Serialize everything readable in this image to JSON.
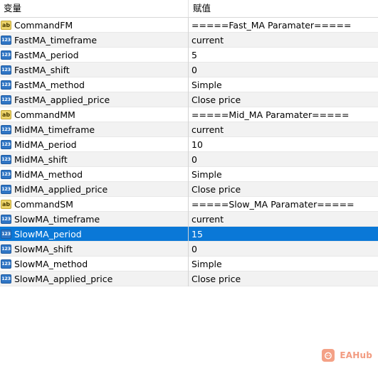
{
  "header": {
    "col_variable": "变量",
    "col_value": "赋值"
  },
  "rows": [
    {
      "icon": "string-type-icon",
      "glyph": "ab",
      "name": "CommandFM",
      "value": "=====Fast_MA Paramater====="
    },
    {
      "icon": "number-type-icon",
      "glyph": "123",
      "name": "FastMA_timeframe",
      "value": "current"
    },
    {
      "icon": "number-type-icon",
      "glyph": "123",
      "name": "FastMA_period",
      "value": "5"
    },
    {
      "icon": "number-type-icon",
      "glyph": "123",
      "name": "FastMA_shift",
      "value": "0"
    },
    {
      "icon": "number-type-icon",
      "glyph": "123",
      "name": "FastMA_method",
      "value": "Simple"
    },
    {
      "icon": "number-type-icon",
      "glyph": "123",
      "name": "FastMA_applied_price",
      "value": "Close price"
    },
    {
      "icon": "string-type-icon",
      "glyph": "ab",
      "name": "CommandMM",
      "value": "=====Mid_MA Paramater====="
    },
    {
      "icon": "number-type-icon",
      "glyph": "123",
      "name": "MidMA_timeframe",
      "value": "current"
    },
    {
      "icon": "number-type-icon",
      "glyph": "123",
      "name": "MidMA_period",
      "value": "10"
    },
    {
      "icon": "number-type-icon",
      "glyph": "123",
      "name": "MidMA_shift",
      "value": "0"
    },
    {
      "icon": "number-type-icon",
      "glyph": "123",
      "name": "MidMA_method",
      "value": "Simple"
    },
    {
      "icon": "number-type-icon",
      "glyph": "123",
      "name": "MidMA_applied_price",
      "value": "Close price"
    },
    {
      "icon": "string-type-icon",
      "glyph": "ab",
      "name": "CommandSM",
      "value": "=====Slow_MA Paramater====="
    },
    {
      "icon": "number-type-icon",
      "glyph": "123",
      "name": "SlowMA_timeframe",
      "value": "current"
    },
    {
      "icon": "number-type-icon",
      "glyph": "123",
      "name": "SlowMA_period",
      "value": "15",
      "selected": true
    },
    {
      "icon": "number-type-icon",
      "glyph": "123",
      "name": "SlowMA_shift",
      "value": "0"
    },
    {
      "icon": "number-type-icon",
      "glyph": "123",
      "name": "SlowMA_method",
      "value": "Simple"
    },
    {
      "icon": "number-type-icon",
      "glyph": "123",
      "name": "SlowMA_applied_price",
      "value": "Close price"
    }
  ],
  "watermark": {
    "text": "EAHub",
    "icon": "eahub-logo-icon"
  },
  "colors": {
    "selection": "#0a78d7",
    "alt_row": "#f2f2f2",
    "number_icon": "#2f75c4",
    "string_icon": "#ecd36a",
    "watermark": "#f29b80"
  }
}
